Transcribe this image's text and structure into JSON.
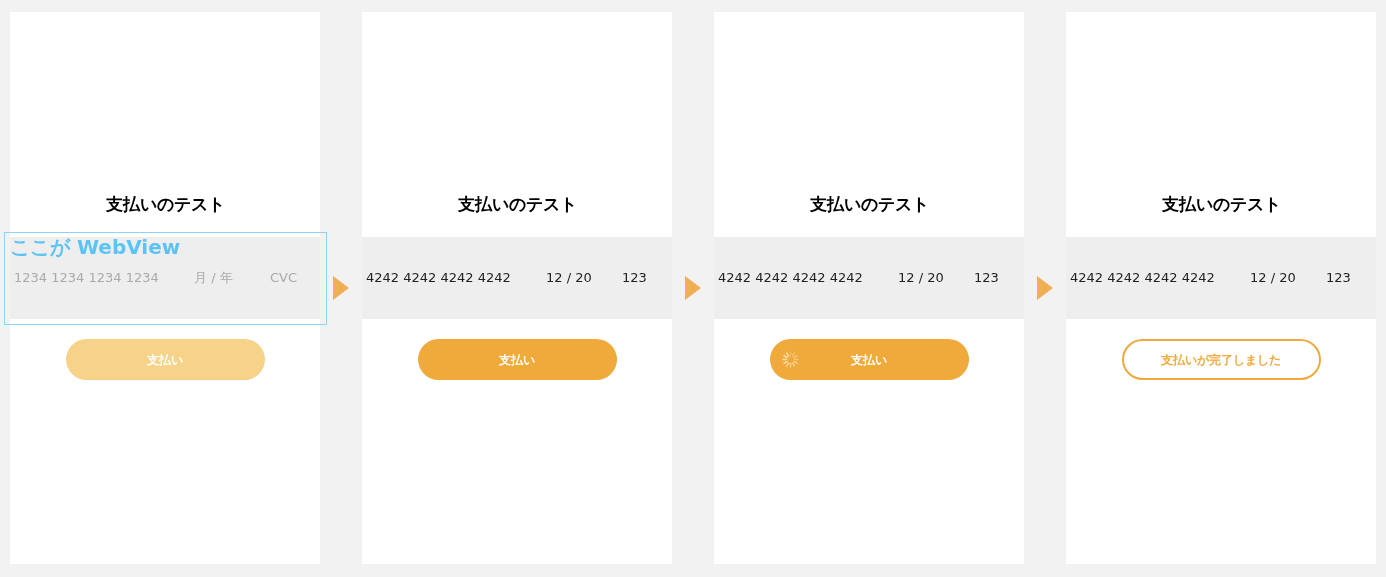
{
  "screens": [
    {
      "title": "支払いのテスト",
      "card": {
        "number": {
          "placeholder": "1234 1234 1234 1234"
        },
        "expiry": {
          "placeholder": "月 / 年"
        },
        "cvc": {
          "placeholder": "CVC"
        }
      },
      "button": {
        "label": "支払い",
        "kind": "disabled"
      },
      "annotation": "ここが WebView"
    },
    {
      "title": "支払いのテスト",
      "card": {
        "number": {
          "value": "4242 4242 4242 4242"
        },
        "expiry": {
          "value": "12 / 20"
        },
        "cvc": {
          "value": "123"
        }
      },
      "button": {
        "label": "支払い",
        "kind": "ready"
      }
    },
    {
      "title": "支払いのテスト",
      "card": {
        "number": {
          "value": "4242 4242 4242 4242"
        },
        "expiry": {
          "value": "12 / 20"
        },
        "cvc": {
          "value": "123"
        }
      },
      "button": {
        "label": "支払い",
        "kind": "loading"
      }
    },
    {
      "title": "支払いのテスト",
      "card": {
        "number": {
          "value": "4242 4242 4242 4242"
        },
        "expiry": {
          "value": "12 / 20"
        },
        "cvc": {
          "value": "123"
        }
      },
      "button": {
        "label": "支払いが完了しました",
        "kind": "done"
      }
    }
  ]
}
